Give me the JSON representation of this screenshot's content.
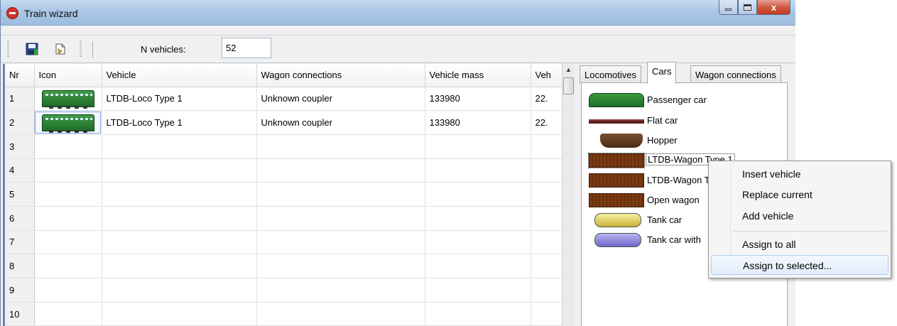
{
  "window": {
    "title": "Train wizard",
    "controls": {
      "close_label": "x"
    }
  },
  "toolbar": {
    "n_vehicles_label": "N vehicles:",
    "n_vehicles_value": "52",
    "icons": [
      "save-icon",
      "export-icon"
    ]
  },
  "grid": {
    "columns": [
      "Nr",
      "Icon",
      "Vehicle",
      "Wagon connections",
      "Vehicle mass",
      "Veh"
    ],
    "rows": [
      {
        "nr": "1",
        "vehicle": "LTDB-Loco Type 1",
        "connection": "Unknown coupler",
        "mass": "133980",
        "extra": "22."
      },
      {
        "nr": "2",
        "vehicle": "LTDB-Loco Type 1",
        "connection": "Unknown coupler",
        "mass": "133980",
        "extra": "22."
      },
      {
        "nr": "3",
        "vehicle": "",
        "connection": "",
        "mass": "",
        "extra": ""
      },
      {
        "nr": "4",
        "vehicle": "",
        "connection": "",
        "mass": "",
        "extra": ""
      },
      {
        "nr": "5",
        "vehicle": "",
        "connection": "",
        "mass": "",
        "extra": ""
      },
      {
        "nr": "6",
        "vehicle": "",
        "connection": "",
        "mass": "",
        "extra": ""
      },
      {
        "nr": "7",
        "vehicle": "",
        "connection": "",
        "mass": "",
        "extra": ""
      },
      {
        "nr": "8",
        "vehicle": "",
        "connection": "",
        "mass": "",
        "extra": ""
      },
      {
        "nr": "9",
        "vehicle": "",
        "connection": "",
        "mass": "",
        "extra": ""
      },
      {
        "nr": "10",
        "vehicle": "",
        "connection": "",
        "mass": "",
        "extra": ""
      }
    ]
  },
  "tabs": {
    "labels": [
      "Locomotives",
      "Cars",
      "Wagon connections"
    ],
    "active": "Cars"
  },
  "cars": [
    {
      "label": "Passenger car"
    },
    {
      "label": "Flat car"
    },
    {
      "label": "Hopper"
    },
    {
      "label": "LTDB-Wagon Type 1"
    },
    {
      "label": "LTDB-Wagon T"
    },
    {
      "label": "Open wagon"
    },
    {
      "label": "Tank car"
    },
    {
      "label": "Tank car with"
    }
  ],
  "context_menu": {
    "items": [
      "Insert vehicle",
      "Replace current",
      "Add vehicle",
      "Assign to all",
      "Assign to selected..."
    ],
    "highlighted": "Assign to selected..."
  }
}
